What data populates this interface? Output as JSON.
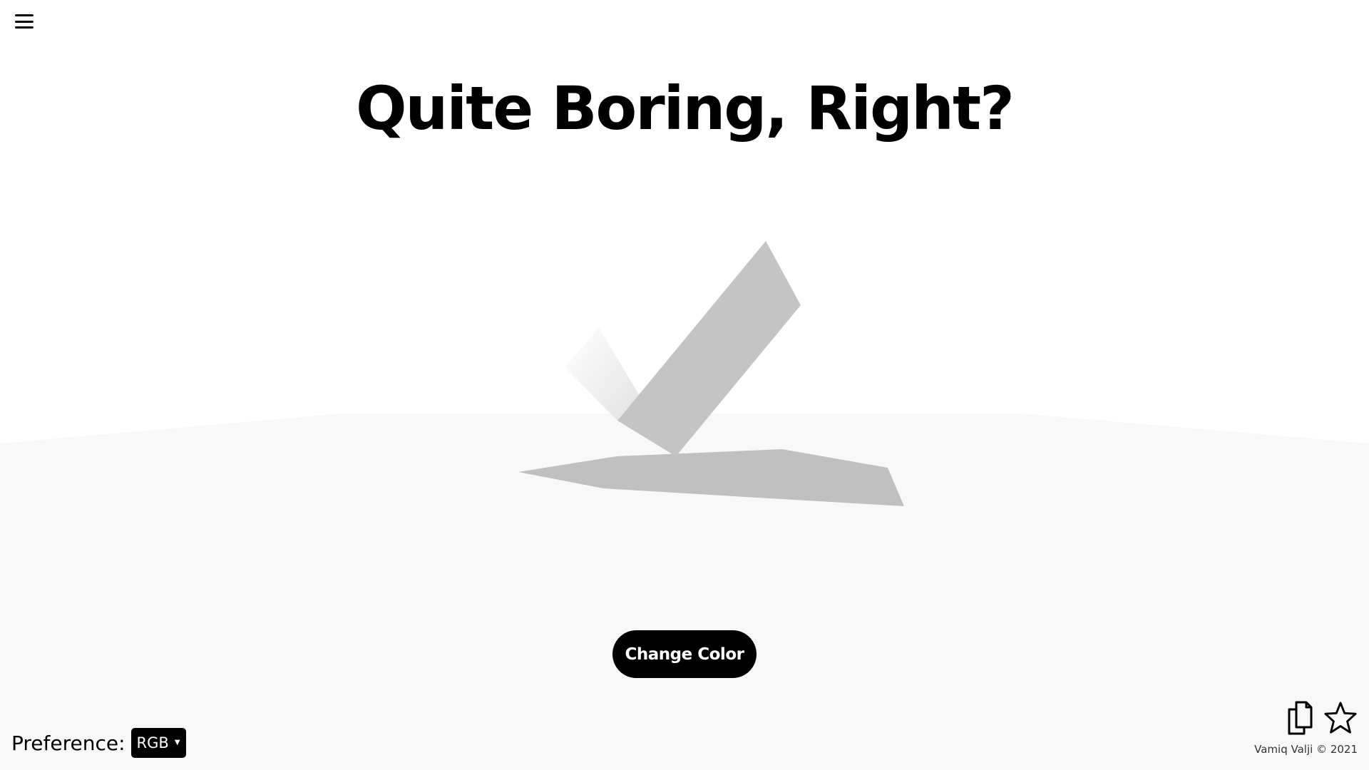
{
  "header": {
    "menu_icon": "hamburger-menu-icon",
    "headline": "Quite Boring, Right?"
  },
  "scene": {
    "shape": "3D checkmark",
    "colors": {
      "background": "#ffffff",
      "floor": "#f8f8f8",
      "checkmark_face": "#c4c4c4",
      "shadow": "#c0c0c0"
    }
  },
  "actions": {
    "change_color_label": "Change Color"
  },
  "footer": {
    "preference_label": "Preference:",
    "preference_value": "RGB",
    "copy_icon": "copy-icon",
    "star_icon": "star-icon",
    "copyright": "Vamiq Valji © 2021"
  }
}
